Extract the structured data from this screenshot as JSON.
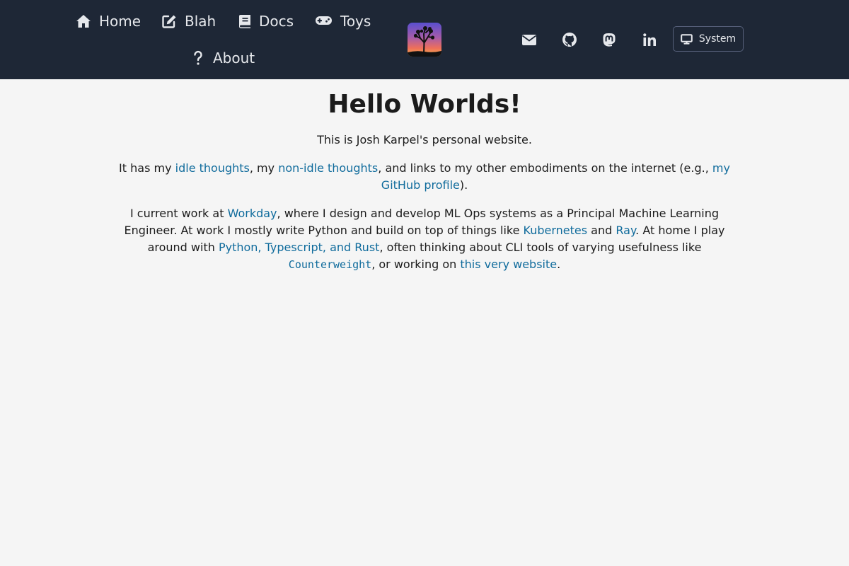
{
  "nav": {
    "home": "Home",
    "blah": "Blah",
    "docs": "Docs",
    "toys": "Toys",
    "about": "About"
  },
  "header": {
    "theme_label": "System",
    "icons": [
      "home-icon",
      "edit-icon",
      "book-icon",
      "gamepad-icon",
      "question-icon",
      "envelope-icon",
      "github-icon",
      "mastodon-icon",
      "linkedin-icon",
      "desktop-icon"
    ]
  },
  "main": {
    "title": "Hello Worlds!",
    "intro": "This is Josh Karpel's personal website.",
    "p2": {
      "t1": "It has my ",
      "link1": "idle thoughts",
      "t2": ", my ",
      "link2": "non-idle thoughts",
      "t3": ", and links to my other embodiments on the internet (e.g., ",
      "link3": "my GitHub profile",
      "t4": ")."
    },
    "p3": {
      "t1": "I current work at ",
      "link_workday": "Workday",
      "t2": ", where I design and develop ML Ops systems as a Principal Machine Learning Engineer. At work I mostly write Python and build on top of things like ",
      "link_kubernetes": "Kubernetes",
      "t3": " and ",
      "link_ray": "Ray",
      "t4": ". At home I play around with ",
      "link_langs": "Python, Typescript, and Rust",
      "t5": ", often thinking about CLI tools of varying usefulness like ",
      "link_counterweight": "Counterweight",
      "t6": ", or working on ",
      "link_website": "this very website",
      "t7": "."
    }
  },
  "colors": {
    "header_bg": "#1e2736",
    "page_bg": "#f5f5f5",
    "link": "#0f6b9c"
  }
}
